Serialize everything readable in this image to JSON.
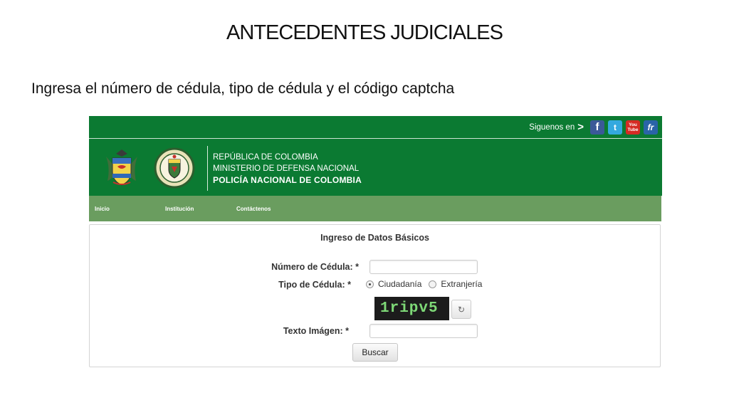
{
  "slide": {
    "title": "ANTECEDENTES JUDICIALES",
    "subtitle": "Ingresa el número de cédula, tipo de cédula y el código captcha"
  },
  "topbar": {
    "follow_label": "Siguenos en",
    "follow_arrow": ">",
    "social": [
      {
        "name": "facebook-icon",
        "glyph": "f",
        "color": "#3b5998"
      },
      {
        "name": "twitter-icon",
        "glyph": "t",
        "color": "#34a9df"
      },
      {
        "name": "youtube-icon",
        "glyph_top": "You",
        "glyph_bottom": "Tube",
        "color": "#d52b24"
      },
      {
        "name": "fr-icon",
        "glyph": "fr",
        "color": "#2a64a8"
      }
    ]
  },
  "header": {
    "line1": "REPÚBLICA DE COLOMBIA",
    "line2": "MINISTERIO DE DEFENSA NACIONAL",
    "line3": "POLICÍA NACIONAL DE COLOMBIA",
    "bg_color": "#0b7a32"
  },
  "nav": {
    "items": [
      {
        "label": "Inicio"
      },
      {
        "label": "Institución"
      },
      {
        "label": "Contáctenos"
      }
    ],
    "bg_color": "#6a9d5f"
  },
  "form": {
    "title": "Ingreso de Datos Básicos",
    "cedula_label": "Número de Cédula: *",
    "cedula_value": "",
    "tipo_label": "Tipo de Cédula: *",
    "tipo_options": [
      {
        "label": "Ciudadanía",
        "selected": true
      },
      {
        "label": "Extranjería",
        "selected": false
      }
    ],
    "captcha_text": "1ripv5",
    "refresh_glyph": "↻",
    "texto_label": "Texto Imágen: *",
    "texto_value": "",
    "submit_label": "Buscar"
  }
}
